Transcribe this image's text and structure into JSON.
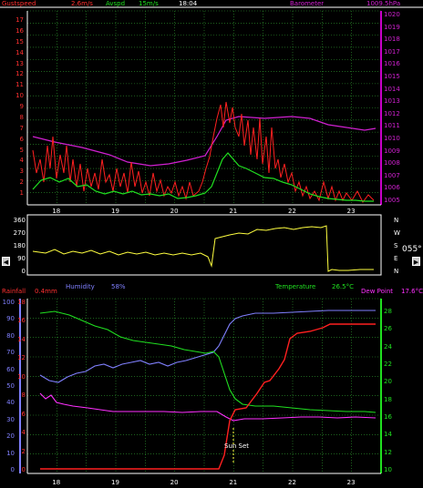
{
  "colors": {
    "background": "#000000",
    "grid": "#2f9b2f",
    "axis_right": "#c800c8",
    "rain": "#ff3030",
    "gust": "#ff2020",
    "avg": "#20e020",
    "baro": "#d020d0",
    "yellow": "#ffff40",
    "humidity": "#8080ff",
    "temp": "#20e020",
    "dew": "#ff30ff",
    "white": "#ffffff"
  },
  "header": {
    "gust_label": "Gustspeed",
    "gust_value": "2.6m/s",
    "avg_label": "Avspd",
    "avg_value": "15m/s",
    "time": "18:04",
    "baro_label": "Barometer",
    "baro_value": "1009.5hPa"
  },
  "wind_panel": {
    "y_left": [
      "17",
      "16",
      "15",
      "14",
      "13",
      "12",
      "11",
      "10",
      "9",
      "8",
      "7",
      "6",
      "5",
      "4",
      "3",
      "2",
      "1"
    ],
    "y_right": [
      "1020",
      "1019",
      "1018",
      "1017",
      "1016",
      "1015",
      "1014",
      "1013",
      "1012",
      "1011",
      "1010",
      "1009",
      "1008",
      "1007",
      "1006",
      "1005"
    ],
    "x_ticks": [
      "18",
      "19",
      "20",
      "21",
      "22",
      "23"
    ]
  },
  "dir_panel": {
    "y_left": [
      "360",
      "270",
      "180",
      "90",
      "0"
    ],
    "compass": [
      "N",
      "W",
      "S",
      "E",
      "N"
    ],
    "readout": "055°",
    "scroll_left_icon": "triangle-left-icon",
    "scroll_right_icon": "triangle-right-icon"
  },
  "th_panel": {
    "humidity_label": "Humidity",
    "humidity_value": "58%",
    "temp_label": "Temperature",
    "temp_value": "26.5°C",
    "rain_label": "Rainfall",
    "rain_value": "0.4mm",
    "dew_label": "Dew Point",
    "dew_value": "17.6°C",
    "y_left_outer": [
      "100",
      "90",
      "80",
      "70",
      "60",
      "50",
      "40",
      "30",
      "20",
      "10",
      "0"
    ],
    "y_left_inner": [
      "18",
      "16",
      "14",
      "12",
      "10",
      "8",
      "6",
      "4",
      "2",
      "0"
    ],
    "y_right": [
      "28",
      "26",
      "24",
      "22",
      "20",
      "18",
      "16",
      "14",
      "12",
      "10"
    ],
    "x_ticks": [
      "18",
      "19",
      "20",
      "21",
      "22",
      "23"
    ],
    "annotation": "Sun Set"
  },
  "chart_data": [
    {
      "type": "line",
      "title": "",
      "series": [
        {
          "name": "Gustspeed"
        },
        {
          "name": "Avspd"
        },
        {
          "name": "Barometer"
        }
      ],
      "x_ticks": [
        "18",
        "19",
        "20",
        "21",
        "22",
        "23"
      ],
      "ylim_left": [
        0,
        17
      ],
      "ylim_right": [
        1005,
        1020
      ]
    },
    {
      "type": "line",
      "title": "",
      "series": [
        {
          "name": "Wind direction",
          "values_desc": "~120 until 20:45 then ~270-330, drop to ~20 at 22:45"
        }
      ],
      "ylim": [
        0,
        360
      ]
    },
    {
      "type": "line",
      "title": "",
      "series": [
        {
          "name": "Humidity"
        },
        {
          "name": "Temperature"
        },
        {
          "name": "Rainfall"
        },
        {
          "name": "Dew Point"
        }
      ],
      "x_ticks": [
        "18",
        "19",
        "20",
        "21",
        "22",
        "23"
      ],
      "ylim_left": [
        0,
        100
      ],
      "ylim_right": [
        10,
        28
      ]
    }
  ]
}
